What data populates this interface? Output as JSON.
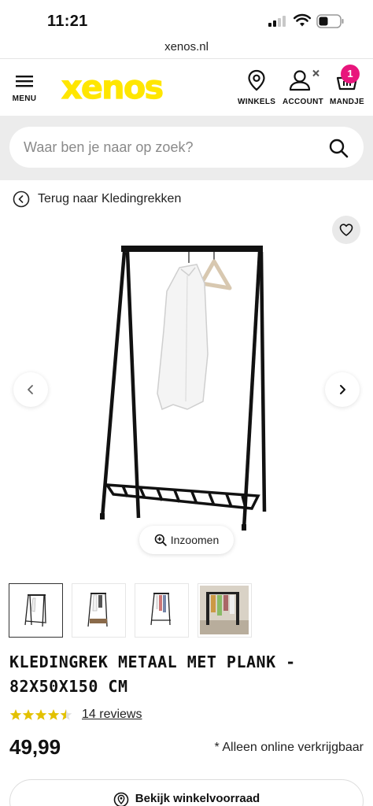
{
  "status_bar": {
    "time": "11:21",
    "icons": [
      "cellular-signal-icon",
      "wifi-icon",
      "battery-icon"
    ]
  },
  "browser": {
    "url": "xenos.nl"
  },
  "header": {
    "menu_label": "MENU",
    "logo_text": "xenos",
    "brand_color": "#ffe600",
    "stores_label": "WINKELS",
    "account_label": "ACCOUNT",
    "cart_label": "MANDJE",
    "cart_count": "1",
    "badge_color": "#e8157c"
  },
  "search": {
    "placeholder": "Waar ben je naar op zoek?"
  },
  "breadcrumb": {
    "back_label": "Terug naar Kledingrekken"
  },
  "gallery": {
    "zoom_label": "Inzoomen",
    "thumbnail_count": 4,
    "active_thumbnail": 1
  },
  "product": {
    "title": "KLEDINGREK METAAL MET PLANK - 82X50X150 CM",
    "rating": 4.5,
    "rating_max": 5,
    "reviews_label": "14 reviews",
    "price": "49,99",
    "availability": "* Alleen online verkrijgbaar",
    "stock_button_label": "Bekijk winkelvoorraad"
  }
}
